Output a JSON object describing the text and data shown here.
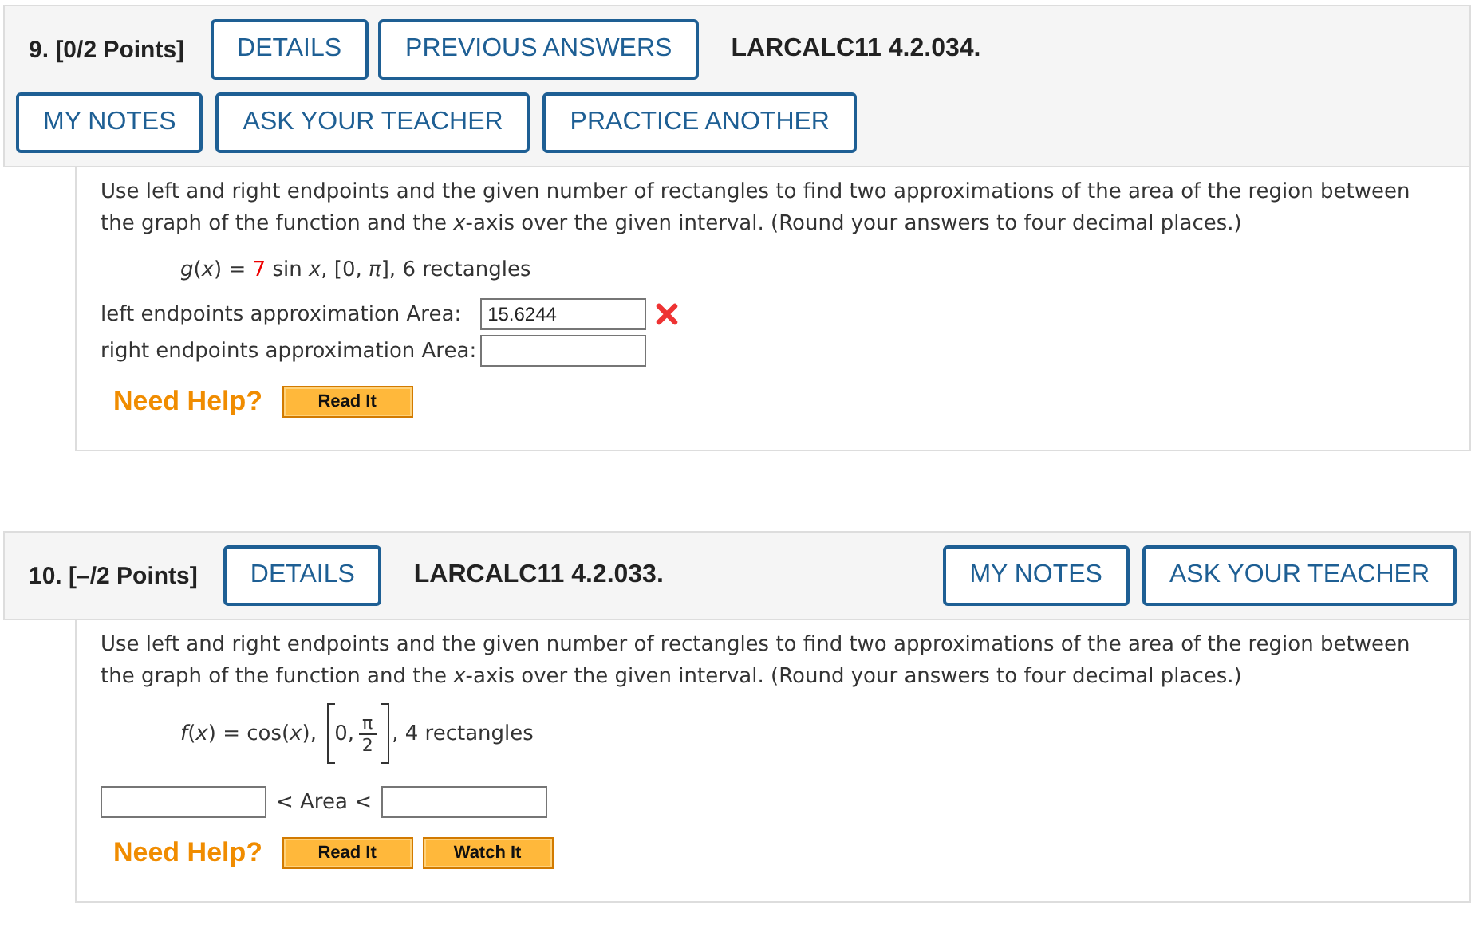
{
  "questions": [
    {
      "number": "9.",
      "points": "[0/2 Points]",
      "buttons": [
        "DETAILS",
        "PREVIOUS ANSWERS"
      ],
      "code": "LARCALC11 4.2.034.",
      "kind": "wrapped",
      "tool_buttons": [
        "MY NOTES",
        "ASK YOUR TEACHER",
        "PRACTICE ANOTHER"
      ],
      "prompt": "Use left and right endpoints and the given number of rectangles to find two approximations of the area of the region between the graph of the function and the *x*-axis over the given interval. (Round your answers to four decimal places.)",
      "formula": [
        {
          "kind": "text",
          "text": "*g*(*x*) = "
        },
        {
          "kind": "highlight",
          "text": "7"
        },
        {
          "kind": "text",
          "text": " sin *x*, [0, *π*], 6 rectangles"
        }
      ],
      "answer": {
        "kind": "labeled",
        "rows": [
          {
            "label": "left endpoints approximation Area:",
            "value": "15.6244",
            "wrong": true
          },
          {
            "label": "right endpoints approximation Area:",
            "wrong": false
          }
        ]
      },
      "help": {
        "label": "Need Help?",
        "buttons": [
          "Read It"
        ]
      }
    },
    {
      "number": "10.",
      "points": "[–/2 Points]",
      "buttons": [
        "DETAILS"
      ],
      "code": "LARCALC11 4.2.033.",
      "kind": "inline",
      "tool_buttons": [
        "MY NOTES",
        "ASK YOUR TEACHER"
      ],
      "prompt": "Use left and right endpoints and the given number of rectangles to find two approximations of the area of the region between the graph of the function and the *x*-axis over the given interval. (Round your answers to four decimal places.)",
      "formula": [
        {
          "kind": "text",
          "text": "*f*(*x*) = cos(*x*), "
        },
        {
          "kind": "interval",
          "start": "0,",
          "numerator": "π",
          "denominator": "2"
        },
        {
          "kind": "text",
          "text": ", 4 rectangles"
        }
      ],
      "answer": {
        "kind": "inequality",
        "middle": "< Area <"
      },
      "help": {
        "label": "Need Help?",
        "buttons": [
          "Read It",
          "Watch It"
        ]
      }
    }
  ]
}
